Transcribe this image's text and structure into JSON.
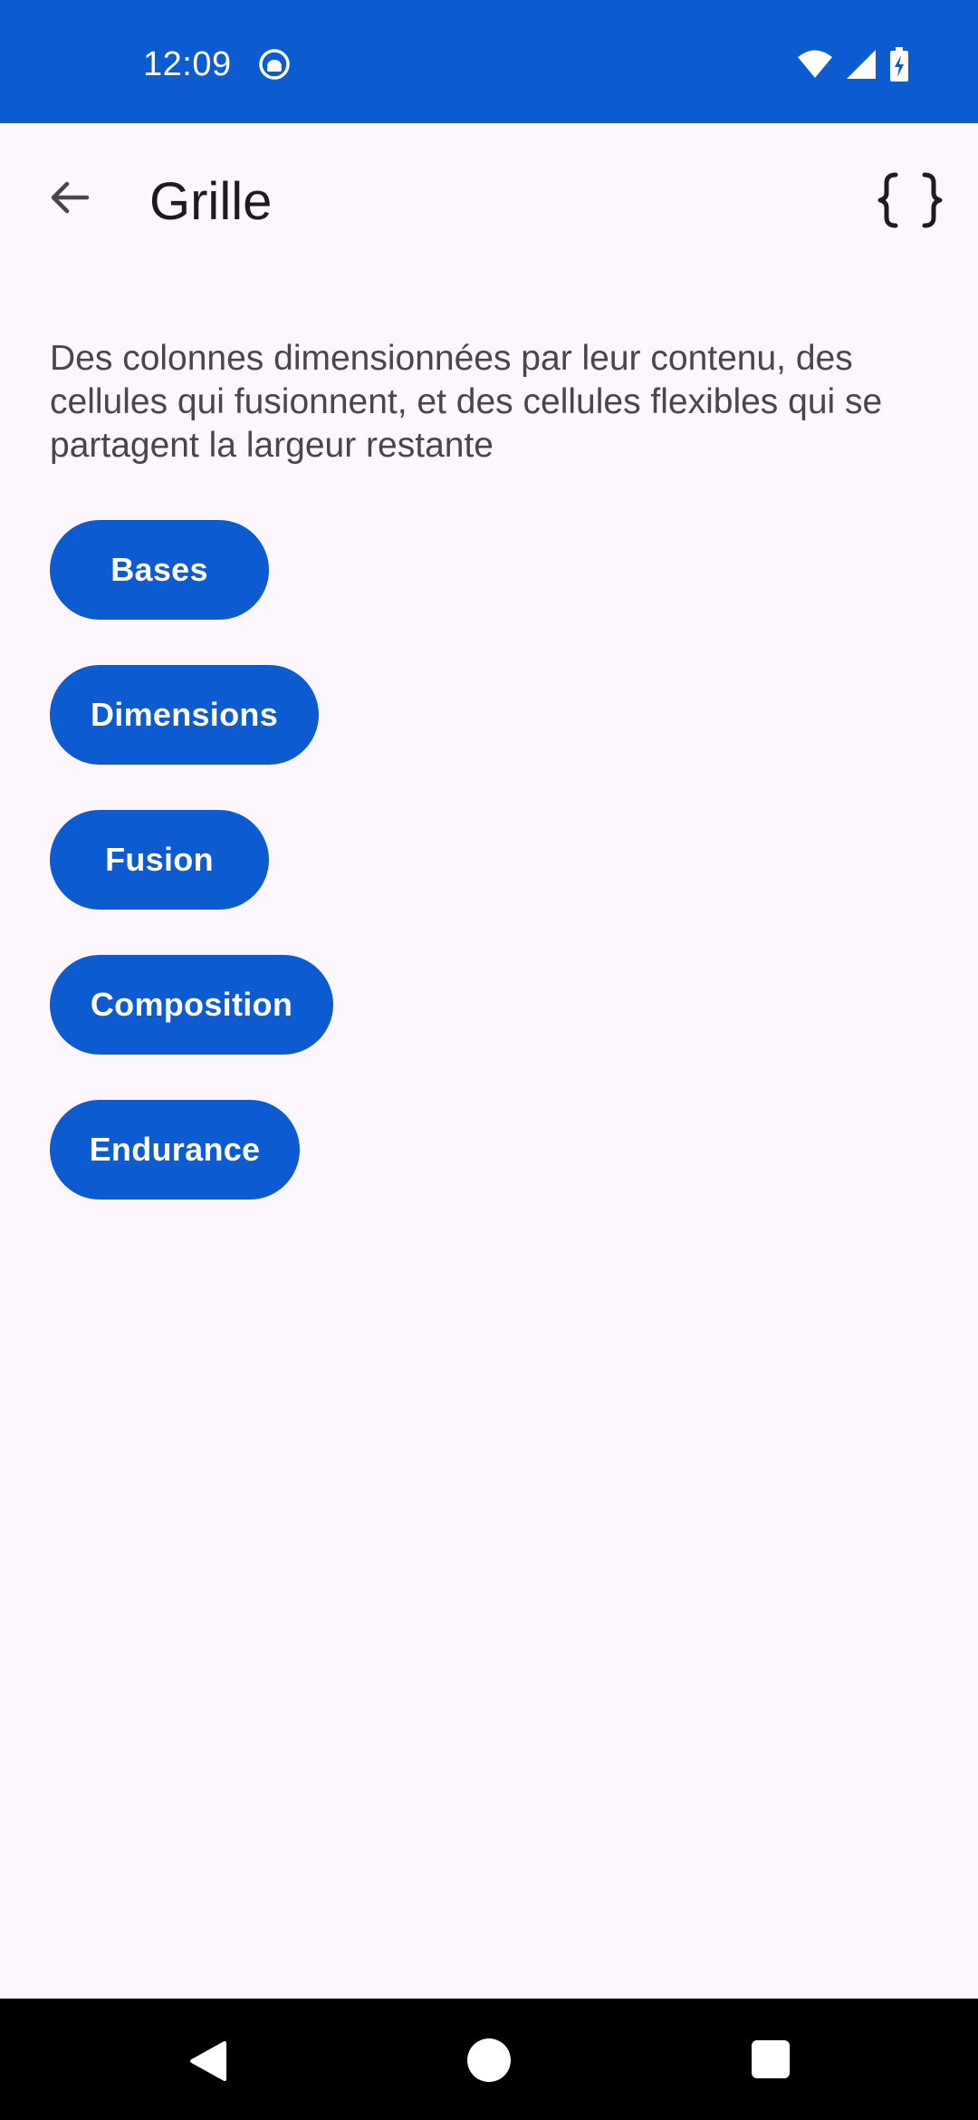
{
  "status_bar": {
    "time": "12:09",
    "background_color": "#0d5bd0",
    "icons": [
      "notification-app-icon",
      "wifi-icon",
      "cellular-signal-icon",
      "battery-charging-icon"
    ]
  },
  "app_bar": {
    "title": "Grille",
    "back_icon": "arrow-back-icon",
    "action_icon": "code-braces-icon"
  },
  "description": "Des colonnes dimensionnées par leur contenu, des cellules qui fusionnent, et des cellules flexibles qui se partagent la largeur restante",
  "buttons": [
    {
      "label": "Bases"
    },
    {
      "label": "Dimensions"
    },
    {
      "label": "Fusion"
    },
    {
      "label": "Composition"
    },
    {
      "label": "Endurance"
    }
  ],
  "accent_color": "#0d5bd0",
  "background_color": "#fdf7fd",
  "nav_bar": {
    "icons": [
      "nav-back-icon",
      "nav-home-icon",
      "nav-recents-icon"
    ]
  }
}
